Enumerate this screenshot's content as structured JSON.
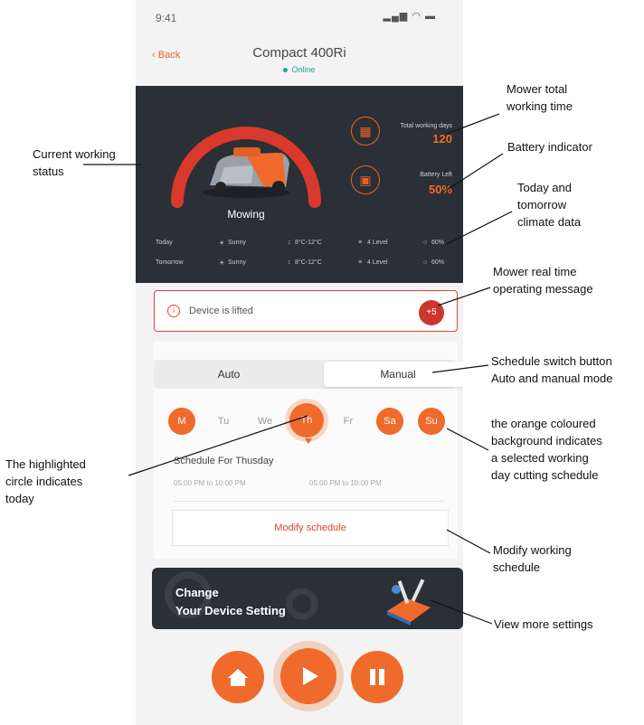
{
  "status_bar": {
    "time": "9:41",
    "icons": "signal-wifi-battery"
  },
  "header": {
    "back_label": "Back",
    "title": "Compact 400Ri",
    "status": "Online"
  },
  "dashboard": {
    "mode": "Mowing",
    "working_days_label": "Total working days",
    "working_days_value": "120",
    "battery_label": "Battery Left",
    "battery_value": "50%",
    "weather": [
      {
        "day": "Today",
        "condition": "Sunny",
        "temp": "8°C-12°C",
        "wind": "4 Level",
        "humidity": "60%"
      },
      {
        "day": "Tomorrow",
        "condition": "Sunny",
        "temp": "8°C-12°C",
        "wind": "4 Level",
        "humidity": "60%"
      }
    ]
  },
  "alert": {
    "message": "Device is lifted",
    "badge": "+5"
  },
  "mode_switch": {
    "auto": "Auto",
    "manual": "Manual",
    "selected": "Manual"
  },
  "days": [
    {
      "label": "M",
      "active": true
    },
    {
      "label": "Tu",
      "active": false
    },
    {
      "label": "We",
      "active": false
    },
    {
      "label": "Th",
      "active": true,
      "today": true
    },
    {
      "label": "Fr",
      "active": false
    },
    {
      "label": "Sa",
      "active": true
    },
    {
      "label": "Su",
      "active": true
    }
  ],
  "schedule": {
    "title": "Schedule For Thusday",
    "slots": [
      "05:00 PM to 10:00 PM",
      "05:00 PM to 10:00 PM"
    ],
    "modify_label": "Modify schedule"
  },
  "settings_banner": {
    "line1": "Change",
    "line2": "Your Device Setting"
  },
  "colors": {
    "accent": "#f06a2c",
    "dark_panel": "#2b2f36",
    "alert": "#e0452a",
    "online": "#1fa39b"
  },
  "annotations": {
    "working_status": [
      "Current working",
      "status"
    ],
    "total_time": [
      "Mower total",
      "working time"
    ],
    "battery": [
      "Battery  indicator"
    ],
    "climate": [
      "Today and",
      "tomorrow",
      "climate data"
    ],
    "message": [
      "Mower real time",
      "operating message"
    ],
    "schedule_switch": [
      "Schedule switch button",
      "Auto and manual mode"
    ],
    "orange_bg": [
      "the orange coloured",
      "background indicates",
      "a selected working",
      "day cutting schedule"
    ],
    "today": [
      "The highlighted",
      "circle indicates",
      "today"
    ],
    "modify": [
      "Modify working",
      "schedule"
    ],
    "more_settings": [
      "View more  settings"
    ]
  }
}
